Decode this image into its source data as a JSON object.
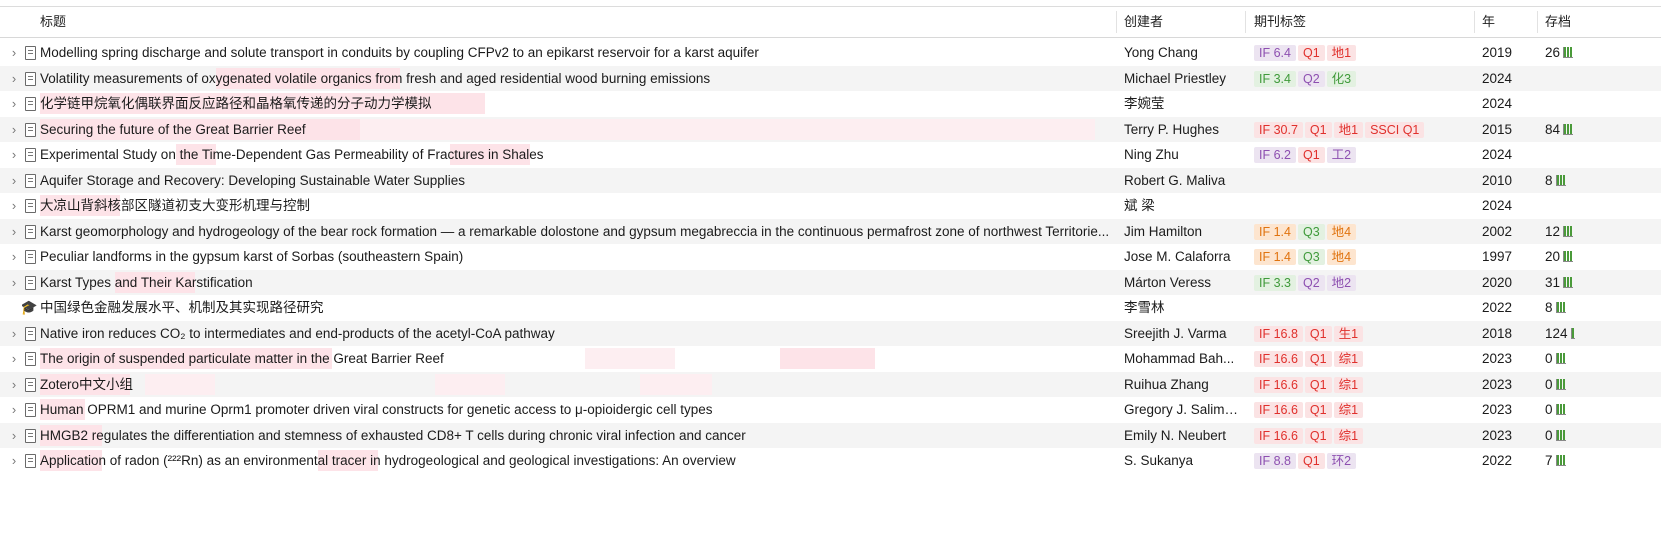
{
  "columns": {
    "title": "标题",
    "creator": "创建者",
    "journal_tags": "期刊标签",
    "year": "年",
    "archive": "存档"
  },
  "colors": {
    "tag_purple": "#8d4fb0",
    "tag_red": "#e0302c",
    "tag_green": "#3f9a3a",
    "tag_orange": "#e0730f",
    "highlight": "#fde3e8"
  },
  "rows": [
    {
      "icon": "document-icon",
      "title": "Modelling spring discharge and solute transport in conduits by coupling CFPv2 to an epikarst reservoir for a karst aquifer",
      "creator": "Yong Chang",
      "tags": [
        {
          "text": "IF 6.4",
          "color": "purple"
        },
        {
          "text": "Q1",
          "color": "red"
        },
        {
          "text": "地1",
          "color": "red"
        }
      ],
      "year": "2019",
      "archive": "26"
    },
    {
      "icon": "document-icon",
      "title": "Volatility measurements of oxygenated volatile organics from fresh and aged residential wood burning emissions",
      "creator": "Michael Priestley",
      "tags": [
        {
          "text": "IF 3.4",
          "color": "green"
        },
        {
          "text": "Q2",
          "color": "purple"
        },
        {
          "text": "化3",
          "color": "green"
        }
      ],
      "year": "2024",
      "archive": ""
    },
    {
      "icon": "document-icon",
      "title": "化学链甲烷氧化偶联界面反应路径和晶格氧传递的分子动力学模拟",
      "creator": "李婉莹",
      "tags": [],
      "year": "2024",
      "archive": ""
    },
    {
      "icon": "document-icon",
      "title": "Securing the future of the Great Barrier Reef",
      "creator": "Terry P. Hughes",
      "tags": [
        {
          "text": "IF 30.7",
          "color": "red"
        },
        {
          "text": "Q1",
          "color": "red"
        },
        {
          "text": "地1",
          "color": "red"
        },
        {
          "text": "SSCI Q1",
          "color": "red"
        }
      ],
      "year": "2015",
      "archive": "84"
    },
    {
      "icon": "document-icon",
      "title": "Experimental Study on the Time-Dependent Gas Permeability of Fractures in Shales",
      "creator": "Ning Zhu",
      "tags": [
        {
          "text": "IF 6.2",
          "color": "purple"
        },
        {
          "text": "Q1",
          "color": "red"
        },
        {
          "text": "工2",
          "color": "purple"
        }
      ],
      "year": "2024",
      "archive": ""
    },
    {
      "icon": "document-icon",
      "title": "Aquifer Storage and Recovery: Developing Sustainable Water Supplies",
      "creator": "Robert G. Maliva",
      "tags": [],
      "year": "2010",
      "archive": "8"
    },
    {
      "icon": "document-icon",
      "title": "大凉山背斜核部区隧道初支大变形机理与控制",
      "creator": "斌 梁",
      "tags": [],
      "year": "2024",
      "archive": ""
    },
    {
      "icon": "document-icon",
      "title": "Karst geomorphology and hydrogeology of the bear rock formation — a remarkable dolostone and gypsum megabreccia in the continuous permafrost zone of northwest Territorie...",
      "creator": "Jim Hamilton",
      "tags": [
        {
          "text": "IF 1.4",
          "color": "orange"
        },
        {
          "text": "Q3",
          "color": "green"
        },
        {
          "text": "地4",
          "color": "orange"
        }
      ],
      "year": "2002",
      "archive": "12"
    },
    {
      "icon": "document-icon",
      "title": "Peculiar landforms in the gypsum karst of Sorbas (southeastern Spain)",
      "creator": "Jose M. Calaforra",
      "tags": [
        {
          "text": "IF 1.4",
          "color": "orange"
        },
        {
          "text": "Q3",
          "color": "green"
        },
        {
          "text": "地4",
          "color": "orange"
        }
      ],
      "year": "1997",
      "archive": "20"
    },
    {
      "icon": "document-icon",
      "title": "Karst Types and Their Karstification",
      "creator": "Márton Veress",
      "tags": [
        {
          "text": "IF 3.3",
          "color": "green"
        },
        {
          "text": "Q2",
          "color": "purple"
        },
        {
          "text": "地2",
          "color": "purple"
        }
      ],
      "year": "2020",
      "archive": "31"
    },
    {
      "icon": "thesis-icon",
      "title": "中国绿色金融发展水平、机制及其实现路径研究",
      "creator": "李雪林",
      "tags": [],
      "year": "2022",
      "archive": "8"
    },
    {
      "icon": "document-icon",
      "title": "Native iron reduces CO₂ to intermediates and end-products of the acetyl-CoA pathway",
      "creator": "Sreejith J. Varma",
      "tags": [
        {
          "text": "IF 16.8",
          "color": "red"
        },
        {
          "text": "Q1",
          "color": "red"
        },
        {
          "text": "生1",
          "color": "red"
        }
      ],
      "year": "2018",
      "archive": "124"
    },
    {
      "icon": "document-icon",
      "title": "The origin of suspended particulate matter in the Great Barrier Reef",
      "creator": "Mohammad Bah...",
      "tags": [
        {
          "text": "IF 16.6",
          "color": "red"
        },
        {
          "text": "Q1",
          "color": "red"
        },
        {
          "text": "综1",
          "color": "red"
        }
      ],
      "year": "2023",
      "archive": "0"
    },
    {
      "icon": "document-icon",
      "title": "Zotero中文小组",
      "creator": "Ruihua Zhang",
      "tags": [
        {
          "text": "IF 16.6",
          "color": "red"
        },
        {
          "text": "Q1",
          "color": "red"
        },
        {
          "text": "综1",
          "color": "red"
        }
      ],
      "year": "2023",
      "archive": "0"
    },
    {
      "icon": "document-icon",
      "title": "Human OPRM1 and murine Oprm1 promoter driven viral constructs for genetic access to μ-opioidergic cell types",
      "creator": "Gregory J. Salima...",
      "tags": [
        {
          "text": "IF 16.6",
          "color": "red"
        },
        {
          "text": "Q1",
          "color": "red"
        },
        {
          "text": "综1",
          "color": "red"
        }
      ],
      "year": "2023",
      "archive": "0"
    },
    {
      "icon": "document-icon",
      "title": "HMGB2 regulates the differentiation and stemness of exhausted CD8+ T cells during chronic viral infection and cancer",
      "creator": "Emily N. Neubert",
      "tags": [
        {
          "text": "IF 16.6",
          "color": "red"
        },
        {
          "text": "Q1",
          "color": "red"
        },
        {
          "text": "综1",
          "color": "red"
        }
      ],
      "year": "2023",
      "archive": "0"
    },
    {
      "icon": "document-icon",
      "title": "Application of radon (²²²Rn) as an environmental tracer in hydrogeological and geological investigations: An overview",
      "creator": "S. Sukanya",
      "tags": [
        {
          "text": "IF 8.8",
          "color": "purple"
        },
        {
          "text": "Q1",
          "color": "red"
        },
        {
          "text": "环2",
          "color": "purple"
        }
      ],
      "year": "2022",
      "archive": "7"
    }
  ]
}
